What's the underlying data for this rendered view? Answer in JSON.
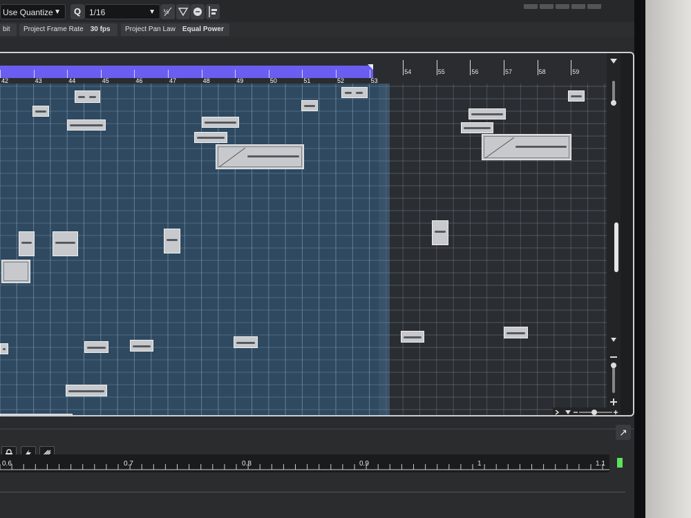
{
  "toolbar": {
    "quantize_mode": "Use Quantize",
    "quantize_btn": "Q",
    "grid_value": "1/16",
    "dropdown_arrow": "▼",
    "icons": [
      "quantize-fraction-icon",
      "iterative-quantize-icon",
      "edit-mode-icon",
      "snap-line-icon"
    ]
  },
  "status": {
    "bit_depth_value": "bit",
    "frame_rate_label": "Project Frame Rate",
    "frame_rate_value": "30 fps",
    "pan_law_label": "Project Pan Law",
    "pan_law_value": "Equal Power"
  },
  "ruler": {
    "bars": [
      "42",
      "43",
      "44",
      "45",
      "46",
      "47",
      "48",
      "49",
      "50",
      "51",
      "52",
      "53",
      "54",
      "55",
      "56",
      "57",
      "58",
      "59"
    ],
    "cycle_end_bar": "53",
    "cycle_color": "#6a5df0"
  },
  "colors": {
    "lane_active": "#2e4960",
    "lane_inactive": "#2a2d31",
    "event": "#c7c9cc"
  },
  "lower": {
    "ruler_labels": [
      "0.6",
      "0.7",
      "0.8",
      "0.9",
      "1",
      "1.1"
    ],
    "buttons": [
      "lock-icon",
      "lightning-icon",
      "cut-icon"
    ]
  }
}
